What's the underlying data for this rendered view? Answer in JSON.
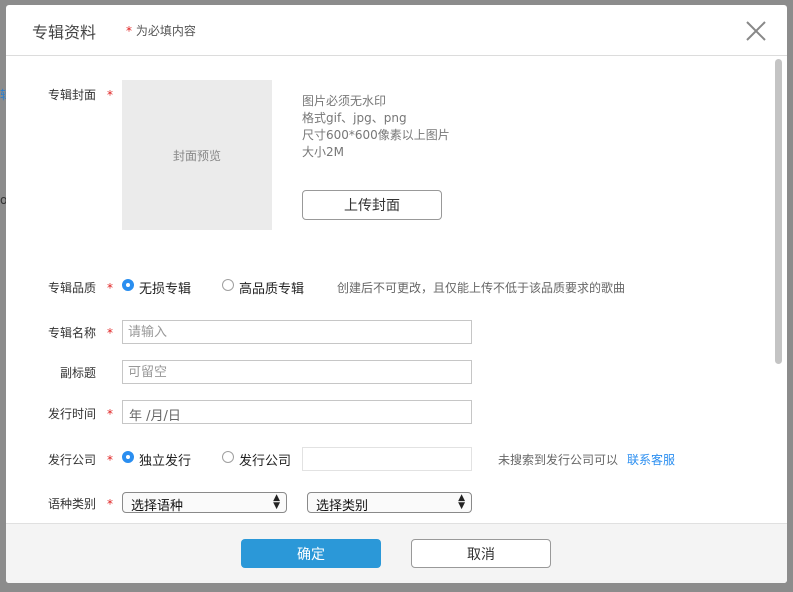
{
  "background": {
    "fragment_1": "辑",
    "fragment_2": "o"
  },
  "header": {
    "title": "专辑资料",
    "required_mark": "*",
    "required_note": "为必填内容"
  },
  "form": {
    "cover": {
      "label": "专辑封面",
      "star": "*",
      "preview_text": "封面预览",
      "notes": [
        "图片必须无水印",
        "格式gif、jpg、png",
        "尺寸600*600像素以上图片",
        "大小2M"
      ],
      "upload_button": "上传封面"
    },
    "quality": {
      "label": "专辑品质",
      "star": "*",
      "options": [
        "无损专辑",
        "高品质专辑"
      ],
      "selected": "无损专辑",
      "hint": "创建后不可更改，且仅能上传不低于该品质要求的歌曲"
    },
    "album_name": {
      "label": "专辑名称",
      "star": "*",
      "placeholder": "请输入",
      "value": ""
    },
    "subtitle": {
      "label": "副标题",
      "placeholder": "可留空",
      "value": ""
    },
    "release_date": {
      "label": "发行时间",
      "star": "*",
      "placeholder": "年 /月/日"
    },
    "company": {
      "label": "发行公司",
      "star": "*",
      "options": [
        "独立发行",
        "发行公司"
      ],
      "selected": "独立发行",
      "input_value": "",
      "hint": "未搜索到发行公司可以",
      "link": "联系客服"
    },
    "language": {
      "label": "语种类别",
      "star": "*",
      "language_select": "选择语种",
      "category_select": "选择类别"
    }
  },
  "footer": {
    "confirm": "确定",
    "cancel": "取消"
  },
  "colors": {
    "primary": "#2b98d8",
    "required": "#e02020",
    "link": "#2a8ef0"
  }
}
